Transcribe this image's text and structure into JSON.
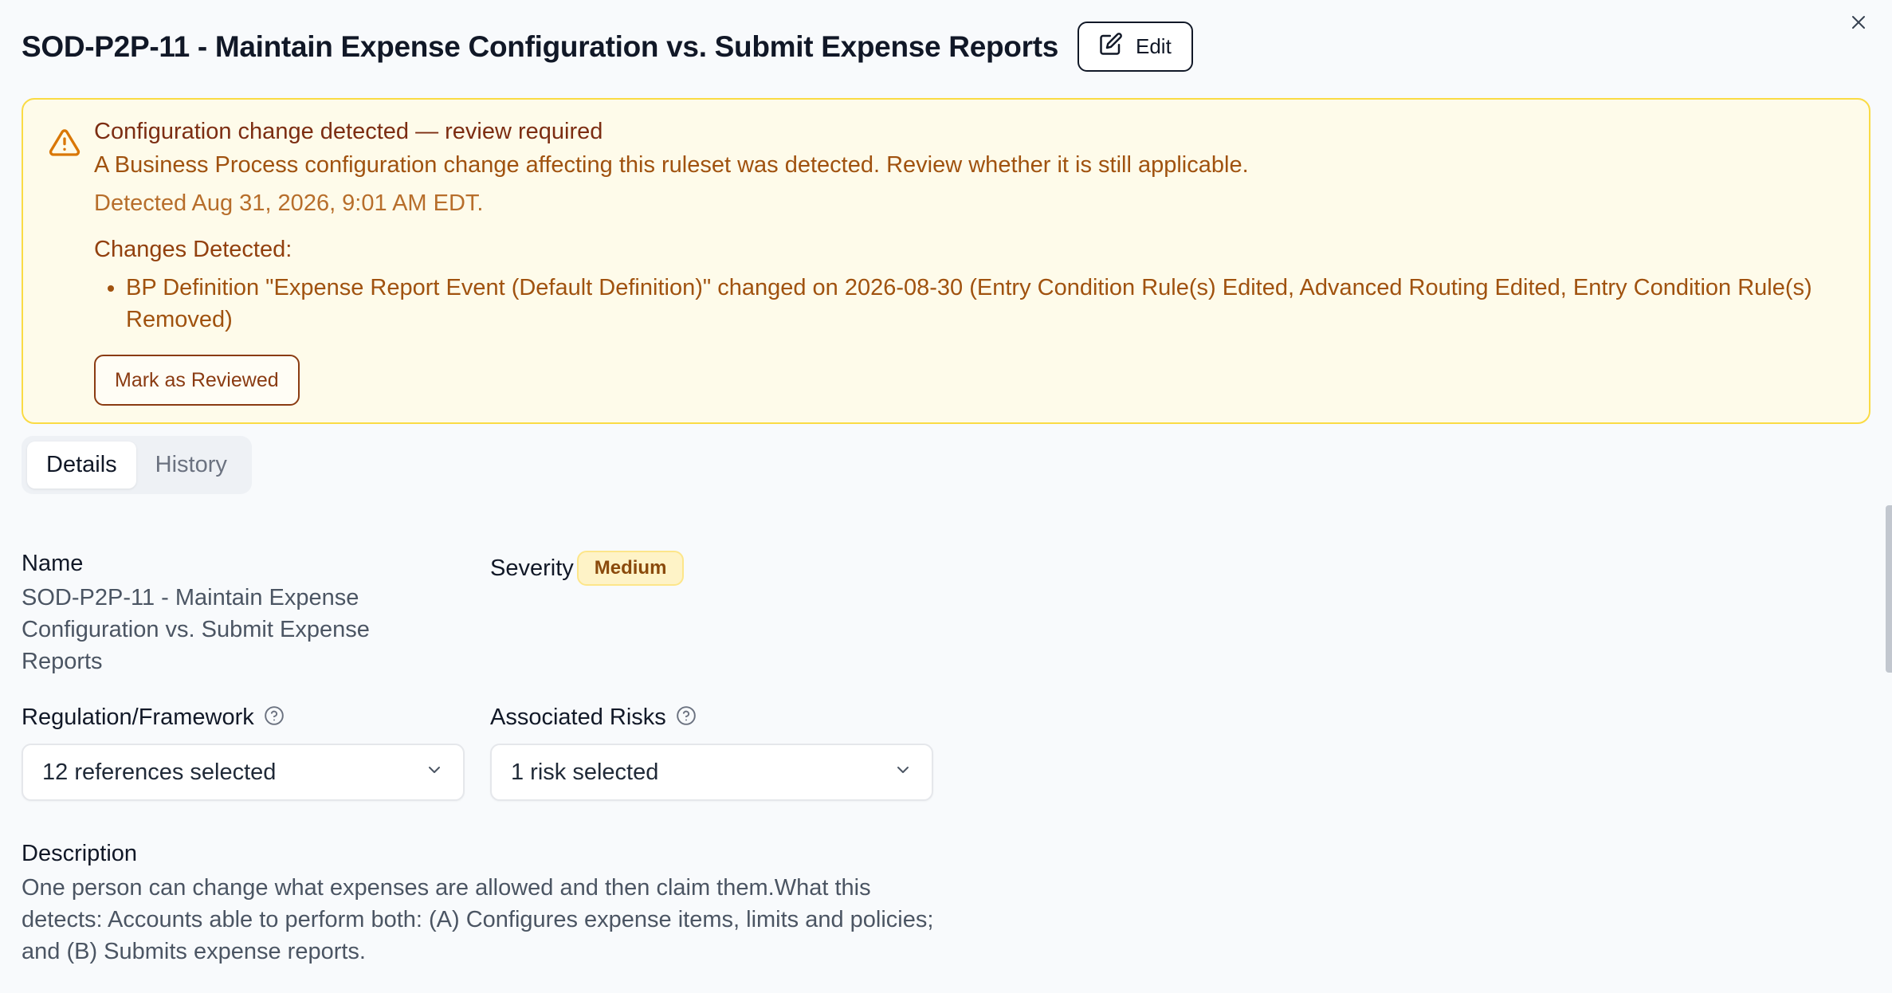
{
  "header": {
    "title": "SOD-P2P-11 - Maintain Expense Configuration vs. Submit Expense Reports",
    "edit_label": "Edit"
  },
  "alert": {
    "heading": "Configuration change detected — review required",
    "description": "A Business Process configuration change affecting this ruleset was detected. Review whether it is still applicable.",
    "detected": "Detected Aug 31, 2026, 9:01 AM EDT.",
    "changes_label": "Changes Detected:",
    "changes": [
      "BP Definition \"Expense Report Event (Default Definition)\" changed on 2026-08-30 (Entry Condition Rule(s) Edited, Advanced Routing Edited, Entry Condition Rule(s) Removed)"
    ],
    "review_button": "Mark as Reviewed"
  },
  "tabs": [
    {
      "label": "Details",
      "active": true
    },
    {
      "label": "History",
      "active": false
    }
  ],
  "details": {
    "name_label": "Name",
    "name_value": "SOD-P2P-11 - Maintain Expense Configuration vs. Submit Expense Reports",
    "severity_label": "Severity",
    "severity_value": "Medium",
    "regulation_label": "Regulation/Framework",
    "regulation_value": "12 references selected",
    "risks_label": "Associated Risks",
    "risks_value": "1 risk selected",
    "description_label": "Description",
    "description_value": "One person can change what expenses are allowed and then claim them.What this detects: Accounts able to perform both: (A) Configures expense items, limits and policies; and (B) Submits expense reports."
  },
  "colors": {
    "alert_bg": "#fefbea",
    "alert_border": "#fadb44",
    "alert_text": "#a0520f",
    "severity_medium_bg": "#fef3c7"
  }
}
